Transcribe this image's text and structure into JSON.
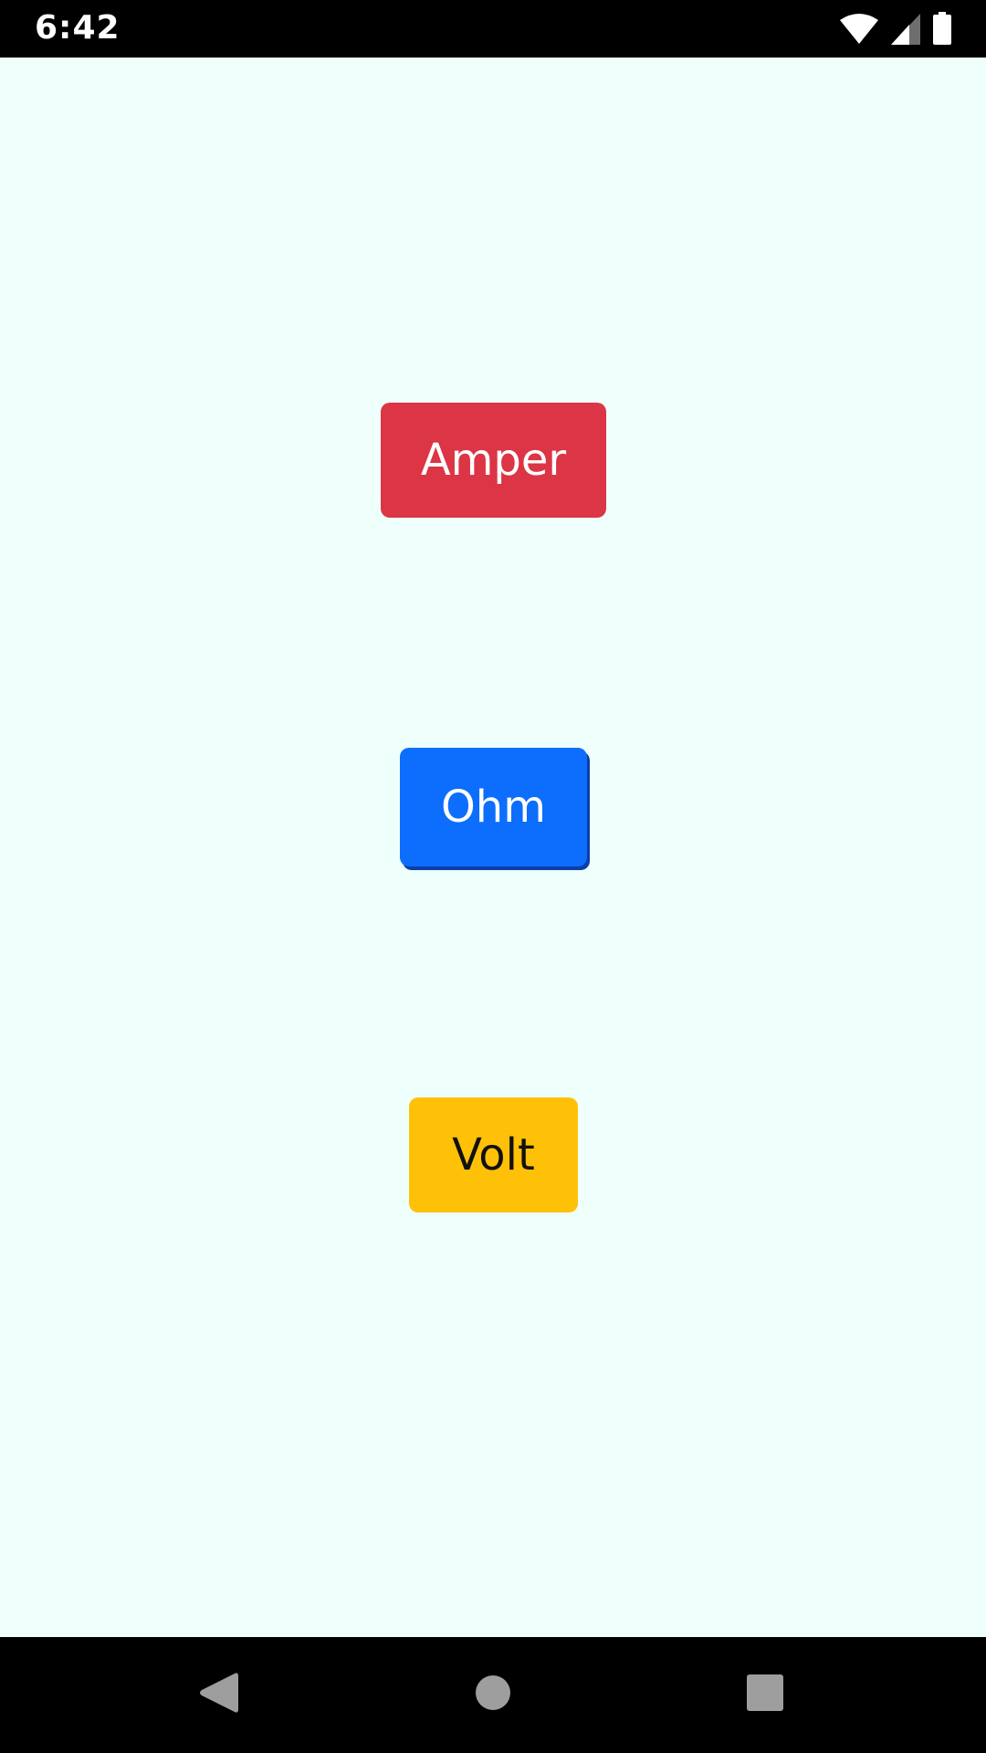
{
  "status_bar": {
    "time": "6:42",
    "icons": [
      "wifi-icon",
      "cellular-signal-icon",
      "battery-icon"
    ]
  },
  "colors": {
    "screen_background": "#eefffc",
    "amper_button": "#dc3545",
    "ohm_button": "#0d6efd",
    "volt_button": "#ffc107",
    "nav_icon": "#9e9e9e"
  },
  "buttons": {
    "amper_label": "Amper",
    "ohm_label": "Ohm",
    "volt_label": "Volt"
  },
  "nav_bar": {
    "icons": [
      "back-icon",
      "home-icon",
      "recent-apps-icon"
    ]
  }
}
